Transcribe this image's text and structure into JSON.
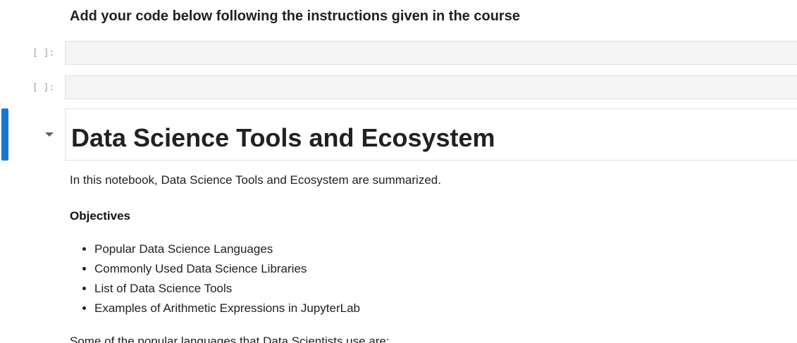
{
  "cells": {
    "instruction_heading": "Add your code below following the instructions given in the course",
    "code_cell_1": {
      "prompt": "[ ]:"
    },
    "code_cell_2": {
      "prompt": "[ ]:"
    },
    "title": "Data Science Tools and Ecosystem",
    "intro": "In this notebook, Data Science Tools and Ecosystem are summarized.",
    "objectives_label": "Objectives",
    "objectives": [
      "Popular Data Science Languages",
      "Commonly Used Data Science Libraries",
      "List of Data Science Tools",
      "Examples of Arithmetic Expressions in JupyterLab"
    ],
    "next_paragraph": "Some of the popular languages that Data Scientists use are:"
  },
  "colors": {
    "active_cell_indicator": "#1976d2",
    "code_cell_background": "#f5f5f5"
  },
  "icons": {
    "collapse": "caret-down-icon"
  }
}
